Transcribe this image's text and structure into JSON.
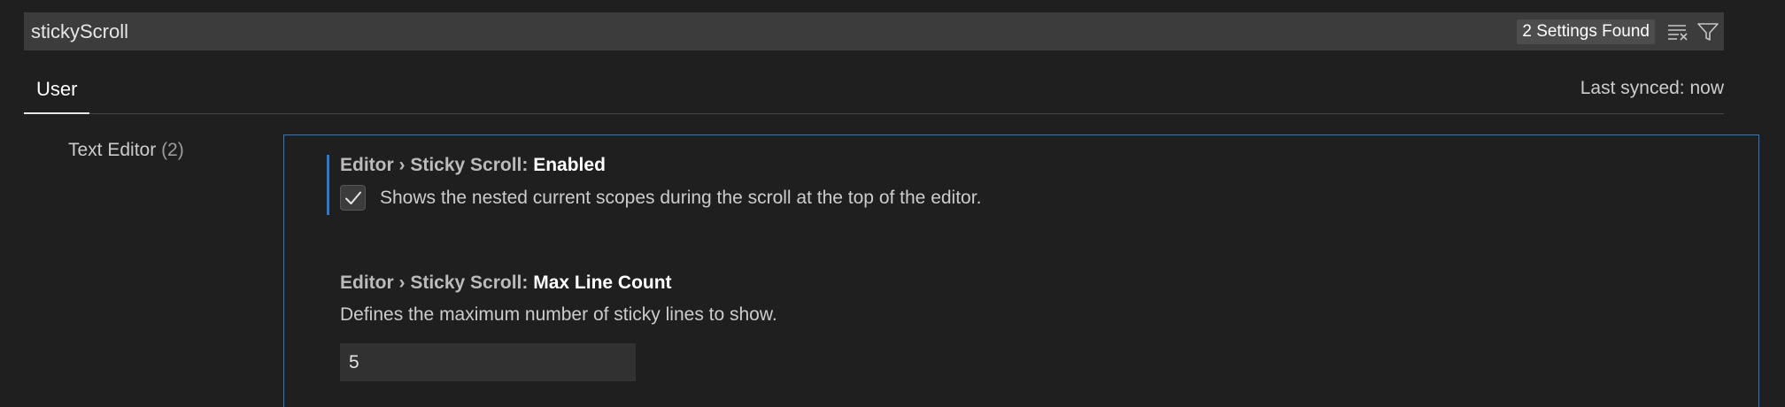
{
  "search": {
    "value": "stickyScroll",
    "results_count": "2 Settings Found",
    "clear_icon": "clear-filter-icon",
    "filter_icon": "filter-icon"
  },
  "tabs": {
    "user_label": "User",
    "sync_status": "Last synced: now"
  },
  "toc": {
    "items": [
      {
        "label": "Text Editor",
        "count": "(2)"
      }
    ]
  },
  "settings": [
    {
      "category": "Editor › Sticky Scroll: ",
      "name": "Enabled",
      "description": "Shows the nested current scopes during the scroll at the top of the editor.",
      "checked": true,
      "modified": true
    },
    {
      "category": "Editor › Sticky Scroll: ",
      "name": "Max Line Count",
      "description": "Defines the maximum number of sticky lines to show.",
      "value": "5"
    }
  ],
  "colors": {
    "focus_border": "#2b79d0",
    "background": "#1f1f1f",
    "input_background": "#3c3c3c"
  }
}
